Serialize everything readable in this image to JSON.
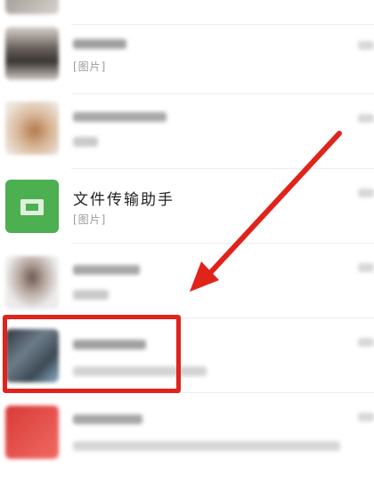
{
  "chats": [
    {
      "name": "",
      "preview": ""
    },
    {
      "name": "",
      "preview": "[图片]"
    },
    {
      "name": "",
      "preview": ""
    },
    {
      "name": "文件传输助手",
      "preview": "[图片]"
    },
    {
      "name": "",
      "preview": ""
    },
    {
      "name": "",
      "preview": ""
    },
    {
      "name": "",
      "preview": ""
    }
  ],
  "colors": {
    "annotation_red": "#e0231b",
    "file_transfer_green": "#4caf50"
  },
  "icons": {
    "file_transfer": "folder-icon"
  }
}
